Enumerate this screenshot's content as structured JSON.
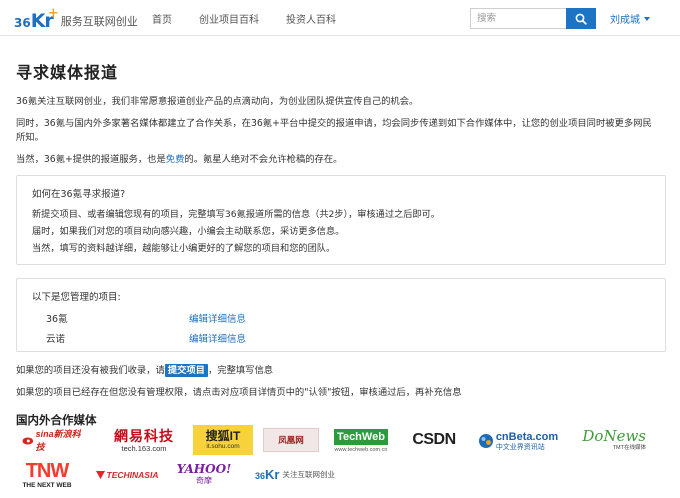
{
  "header": {
    "logo_mark": "36",
    "logo_mark_kr": "Kr",
    "logo_text": "服务互联网创业",
    "nav": [
      "首页",
      "创业项目百科",
      "投资人百科"
    ],
    "search_placeholder": "搜索",
    "user_name": "刘成城"
  },
  "main": {
    "title": "寻求媒体报道",
    "intro1": "36氪关注互联网创业，我们非常愿意报道创业产品的点滴动向，为创业团队提供宣传自己的机会。",
    "intro2": "同时，36氪与国内外多家著名媒体都建立了合作关系，在36氪+平台中提交的报道申请，均会同步传递到如下合作媒体中，让您的创业项目同时被更多网民所知。",
    "intro3_a": "当然，36氪+提供的报道服务，也是",
    "intro3_link": "免费",
    "intro3_b": "的。氪星人绝对不会允许枪稿的存在。",
    "how_box": {
      "title": "如何在36氪寻求报道?",
      "lines": [
        "新提交项目、或者编辑您现有的项目，完整填写36氪报道所需的信息（共2步），审核通过之后即可。",
        "届时，如果我们对您的项目动向感兴趣，小编会主动联系您，采访更多信息。",
        "当然，填写的资料越详细，越能够让小编更好的了解您的项目和您的团队。"
      ]
    },
    "projects_box": {
      "title": "以下是您管理的项目:",
      "rows": [
        {
          "name": "36氪",
          "action": "编辑详细信息"
        },
        {
          "name": "云诺",
          "action": "编辑详细信息"
        }
      ]
    },
    "submit_line_a": "如果您的项目还没有被我们收录，请",
    "submit_button": "提交项目",
    "submit_line_b": "，完整填写信息",
    "claim_line": "如果您的项目已经存在但您没有管理权限，请点击对应项目详情页中的\"认领\"按钮，审核通过后，再补充信息",
    "partners_title": "国内外合作媒体"
  },
  "partners": {
    "sina": "sina新浪科技",
    "netease_top": "網易科技",
    "netease_sub": "tech.163.com",
    "sohu_top": "搜狐IT",
    "sohu_sub": "it.sohu.com",
    "ifeng": "凤凰网",
    "techweb": "TechWeb",
    "techweb_sub": "www.techweb.com.cn",
    "csdn": "CSDN",
    "cnbeta": "cnBeta.com",
    "cnbeta_sub": "中文业界资讯站",
    "donews": "DoNews",
    "donews_sub": "TMT在线媒体",
    "tnw": "TNW",
    "tnw_sub": "THE NEXT WEB",
    "techinasia": "TECHINASIA",
    "yahoo": "YAHOO!",
    "yahoo_sub": "奇摩",
    "kr36_text": "关注互联网创业"
  },
  "colors": {
    "brand_blue": "#1d6fbf",
    "button_blue": "#1d73c4",
    "accent_orange": "#f2a51a"
  }
}
